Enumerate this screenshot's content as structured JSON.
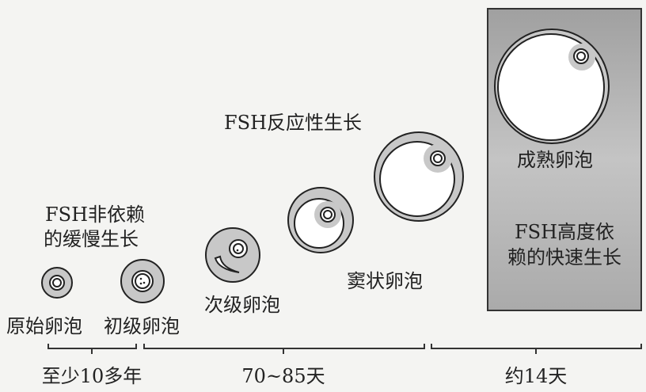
{
  "labels": {
    "phase1": "FSH非依赖\n的缓慢生长",
    "phase1_line1": "FSH非依赖",
    "phase1_line2": "的缓慢生长",
    "phase2": "FSH反应性生长",
    "phase3_line1": "FSH高度依",
    "phase3_line2": "赖的快速生长"
  },
  "stages": [
    {
      "name": "原始卵泡"
    },
    {
      "name": "初级卵泡"
    },
    {
      "name": "次级卵泡"
    },
    {
      "name": "窦状卵泡"
    },
    {
      "name": "成熟卵泡"
    }
  ],
  "durations": [
    {
      "text": "至少10多年"
    },
    {
      "text": "70~85天"
    },
    {
      "text": "约14天"
    }
  ],
  "colors": {
    "granulosa": "#c8c8c8",
    "box": "#a9a9a9",
    "line": "#222222"
  }
}
